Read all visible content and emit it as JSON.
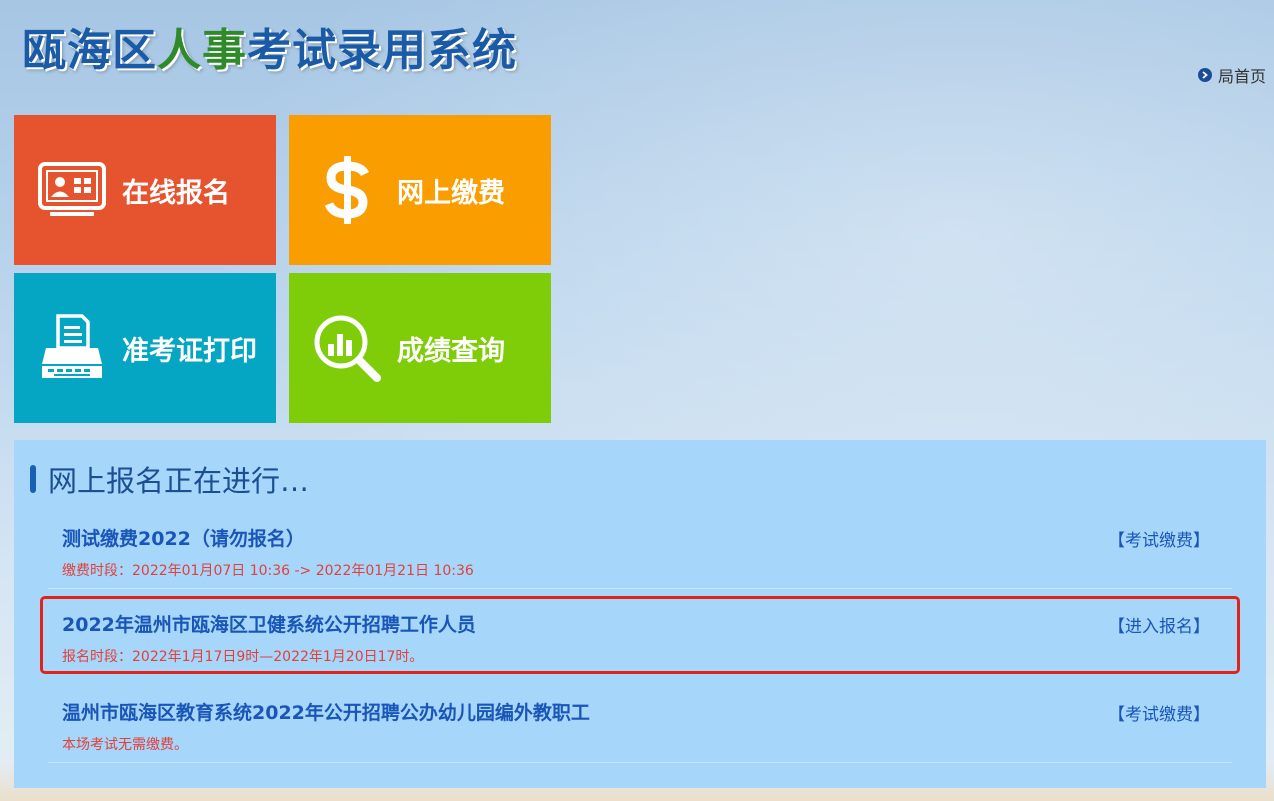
{
  "header": {
    "logo_part1": "瓯海区",
    "logo_part2": "人事",
    "logo_part3": "考试录用系统",
    "home_link": "局首页"
  },
  "tiles": [
    {
      "label": "在线报名",
      "icon": "registration-screen-icon",
      "color": "#e6532f"
    },
    {
      "label": "网上缴费",
      "icon": "dollar-icon",
      "color": "#f99d00"
    },
    {
      "label": "准考证打印",
      "icon": "printer-icon",
      "color": "#04a6c3"
    },
    {
      "label": "成绩查询",
      "icon": "magnifier-chart-icon",
      "color": "#7fcd08"
    }
  ],
  "panel": {
    "title": "网上报名正在进行…",
    "items": [
      {
        "name": "测试缴费2022（请勿报名）",
        "sub": "缴费时段：2022年01月07日 10:36 -> 2022年01月21日 10:36",
        "action": "【考试缴费】"
      },
      {
        "name": "2022年温州市瓯海区卫健系统公开招聘工作人员",
        "sub": "报名时段：2022年1月17日9时—2022年1月20日17时。",
        "action": "【进入报名】"
      },
      {
        "name": "温州市瓯海区教育系统2022年公开招聘公办幼儿园编外教职工",
        "sub": "本场考试无需缴费。",
        "action": "【考试缴费】"
      }
    ]
  },
  "colors": {
    "accent_blue": "#1a56b8",
    "sub_red": "#e1413a",
    "highlight_red": "#e2231a"
  }
}
